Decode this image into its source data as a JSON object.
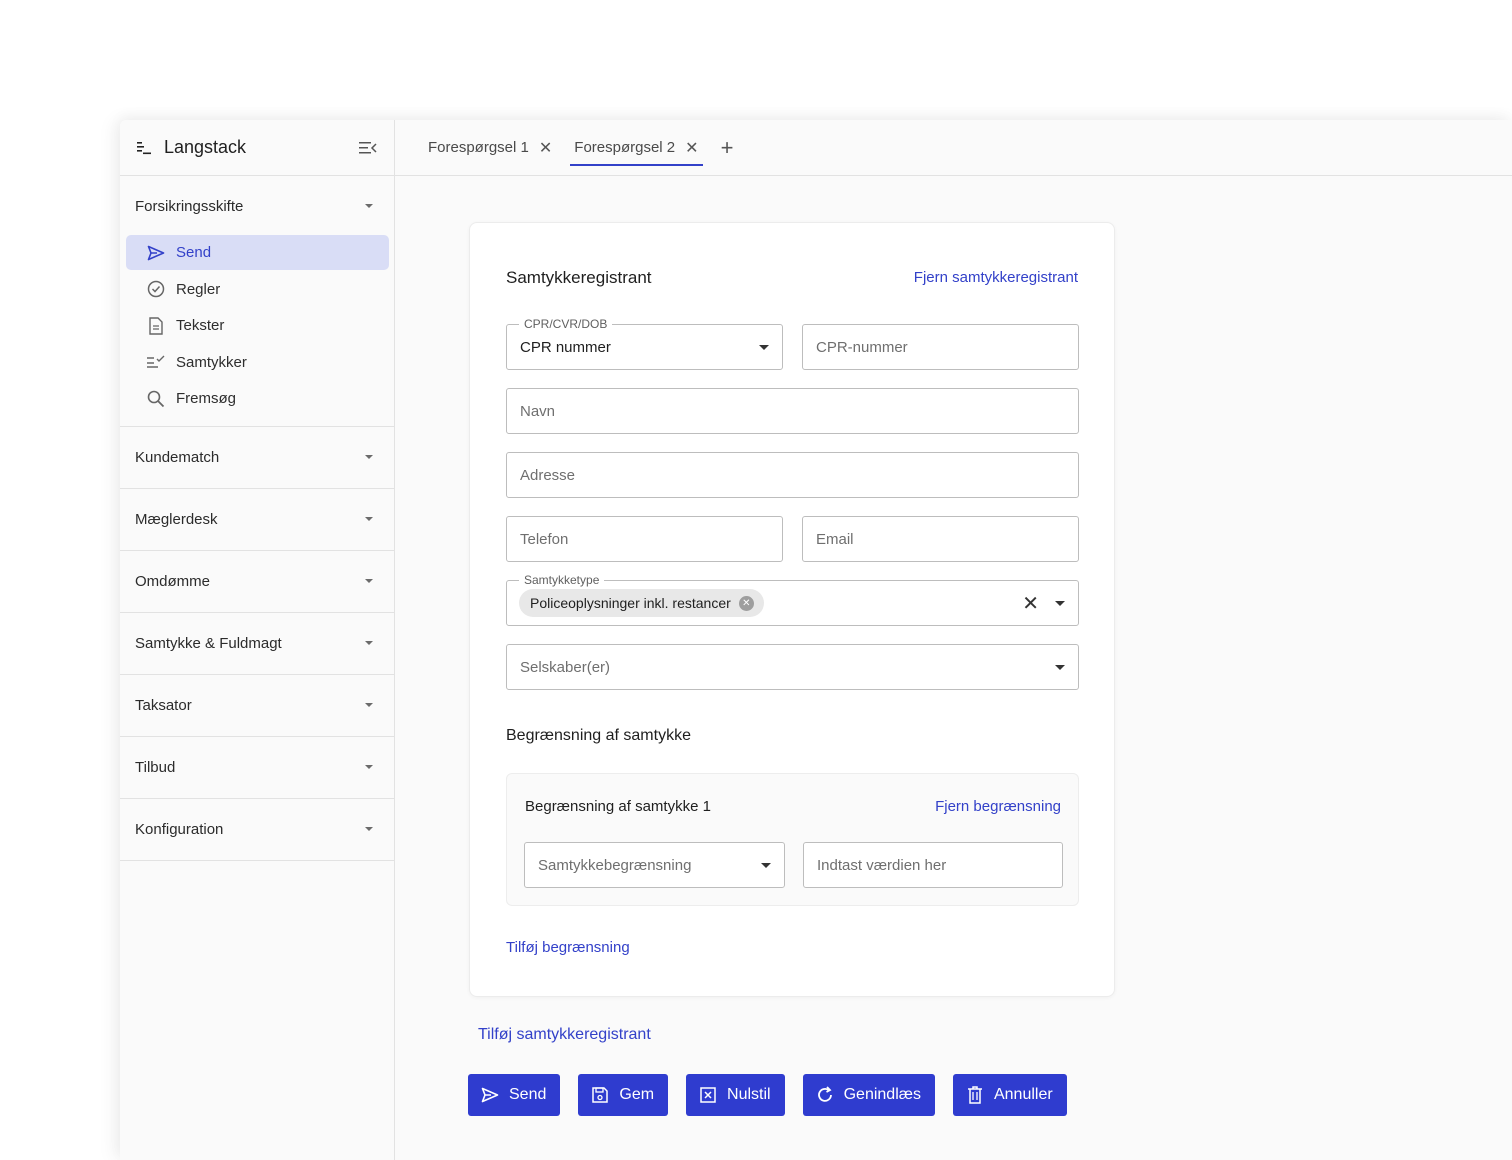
{
  "app": {
    "name": "Langstack"
  },
  "sidebar": {
    "open_section": {
      "label": "Forsikringsskifte",
      "items": [
        {
          "label": "Send",
          "icon": "send-icon",
          "active": true
        },
        {
          "label": "Regler",
          "icon": "check-circle-icon"
        },
        {
          "label": "Tekster",
          "icon": "document-icon"
        },
        {
          "label": "Samtykker",
          "icon": "checklist-icon"
        },
        {
          "label": "Fremsøg",
          "icon": "search-icon"
        }
      ]
    },
    "sections": [
      {
        "label": "Kundematch"
      },
      {
        "label": "Mæglerdesk"
      },
      {
        "label": "Omdømme"
      },
      {
        "label": "Samtykke & Fuldmagt"
      },
      {
        "label": "Taksator"
      },
      {
        "label": "Tilbud"
      },
      {
        "label": "Konfiguration"
      }
    ]
  },
  "tabs": [
    {
      "label": "Forespørgsel 1",
      "active": false
    },
    {
      "label": "Forespørgsel 2",
      "active": true
    }
  ],
  "form": {
    "title": "Samtykkeregistrant",
    "remove_link": "Fjern samtykkeregistrant",
    "id_type": {
      "label": "CPR/CVR/DOB",
      "value": "CPR nummer"
    },
    "cpr_placeholder": "CPR-nummer",
    "name_placeholder": "Navn",
    "address_placeholder": "Adresse",
    "phone_placeholder": "Telefon",
    "email_placeholder": "Email",
    "consent_type": {
      "label": "Samtykketype",
      "chip": "Policeoplysninger inkl. restancer"
    },
    "companies_placeholder": "Selskaber(er)",
    "restriction_heading": "Begrænsning af samtykke",
    "restriction": {
      "title": "Begrænsning af samtykke 1",
      "remove_link": "Fjern begrænsning",
      "select_placeholder": "Samtykkebegrænsning",
      "value_placeholder": "Indtast værdien her"
    },
    "add_restriction": "Tilføj begrænsning"
  },
  "add_registrant": "Tilføj samtykkeregistrant",
  "actions": [
    {
      "label": "Send",
      "icon": "send-icon"
    },
    {
      "label": "Gem",
      "icon": "save-icon"
    },
    {
      "label": "Nulstil",
      "icon": "reset-icon"
    },
    {
      "label": "Genindlæs",
      "icon": "reload-icon"
    },
    {
      "label": "Annuller",
      "icon": "trash-icon"
    }
  ],
  "colors": {
    "accent": "#2f3ccf",
    "active_bg": "#d9ddf6"
  }
}
